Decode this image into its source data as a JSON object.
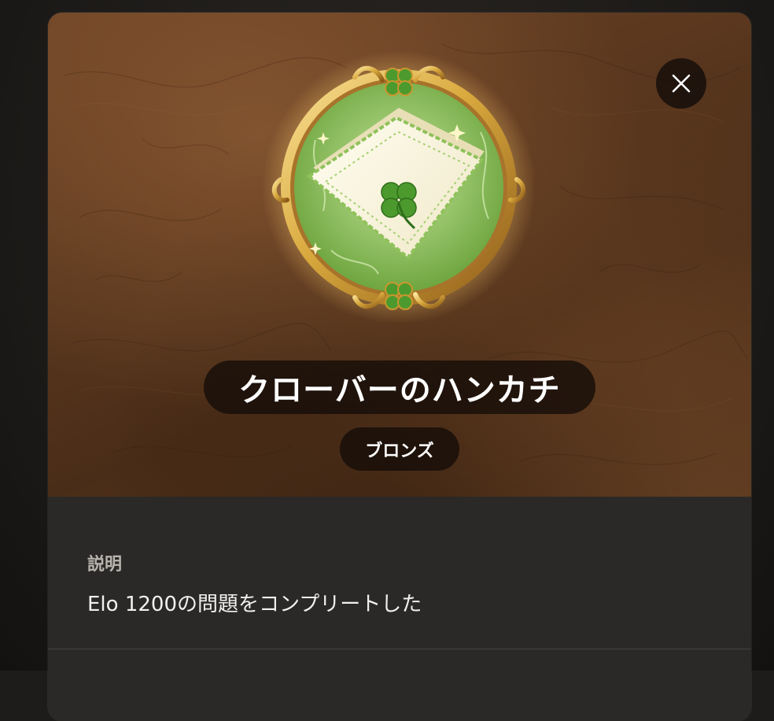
{
  "achievement": {
    "title": "クローバーのハンカチ",
    "rank": "ブロンズ",
    "badge_icon": "clover-handkerchief-medal"
  },
  "description": {
    "label": "説明",
    "text": "Elo 1200の問題をコンプリートした"
  },
  "controls": {
    "close_icon": "close-icon"
  },
  "colors": {
    "hero_background": "#5a371e",
    "panel_background": "#2b2927",
    "pill_background": "#160e09",
    "medal_gold": "#d9a93e",
    "medal_green": "#8fc25a"
  }
}
